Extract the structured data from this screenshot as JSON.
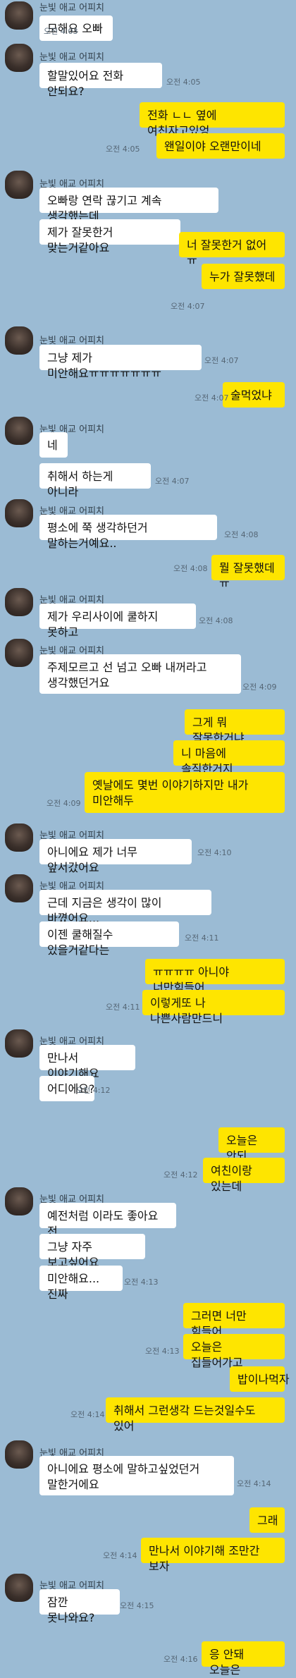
{
  "sender_name": "눈빛 애교 어피치",
  "messages": [
    {
      "text": "모해요 오빠",
      "time": "오전 4:03"
    },
    {
      "text": "할말있어요 전화 안되요?",
      "time": "오전 4:05"
    },
    {
      "text": "전화 ㄴㄴ 옆에 여친자고있엉",
      "time": ""
    },
    {
      "text": "왠일이야 오랜만이네",
      "time": "오전 4:05"
    },
    {
      "text": "오빠랑 연락 끊기고 계속 생각했는데",
      "time": ""
    },
    {
      "text": "제가 잘못한거 맞는거같아요",
      "time": "오전 4:06"
    },
    {
      "text": "너 잘못한거 없어 ㅠ",
      "time": ""
    },
    {
      "text": "누가 잘못했데",
      "time": "오전 4:07"
    },
    {
      "text": "그냥 제가 미안해요ㅠㅠㅠㅠㅠㅠㅠ",
      "time": "오전 4:07"
    },
    {
      "text": "술먹었냐",
      "time": "오전 4:07"
    },
    {
      "text": "네",
      "time": ""
    },
    {
      "text": "취해서 하는게 아니라",
      "time": "오전 4:07"
    },
    {
      "text": "평소에 쭉 생각하던거 말하는거예요..",
      "time": "오전 4:08"
    },
    {
      "text": "뭘 잘못했데 ㅠ",
      "time": "오전 4:08"
    },
    {
      "text": "제가 우리사이에 쿨하지 못하고",
      "time": "오전 4:08"
    },
    {
      "text": "주제모르고 선 넘고 오빠 내꺼라고 생각했던거요",
      "time": "오전 4:09"
    },
    {
      "text": "그게 뭐 잘못한거냐",
      "time": ""
    },
    {
      "text": "니 마음에 솔직한거지",
      "time": ""
    },
    {
      "text": "옛날에도 몇번 이야기하지만 내가 미안해두",
      "time": "오전 4:09"
    },
    {
      "text": "아니에요 제가 너무 앞서갔어요",
      "time": "오전 4:10"
    },
    {
      "text": "근데 지금은 생각이 많이 바꼈어요...",
      "time": ""
    },
    {
      "text": "이젠 쿨해질수 있을거같다는",
      "time": "오전 4:11"
    },
    {
      "text": "ㅠㅠㅠㅠ 아니야 너만힘들어",
      "time": ""
    },
    {
      "text": "이렇게또 나 나쁜사람만드니",
      "time": "오전 4:11"
    },
    {
      "text": "만나서 이야기해요",
      "time": ""
    },
    {
      "text": "어디에요?",
      "time": "오전 4:12"
    },
    {
      "text": "오늘은 안되",
      "time": ""
    },
    {
      "text": "여친이랑 있는데",
      "time": "오전 4:12"
    },
    {
      "text": "예전처럼 이라도 좋아요 전",
      "time": ""
    },
    {
      "text": "그냥 자주 보고싶어요",
      "time": ""
    },
    {
      "text": "미안해요...진짜",
      "time": "오전 4:13"
    },
    {
      "text": "그러면 너만 힘들어",
      "time": ""
    },
    {
      "text": "오늘은 집들어가고",
      "time": "오전 4:13"
    },
    {
      "text": "밥이나먹자",
      "time": ""
    },
    {
      "text": "취해서 그런생각 드는것일수도 있어",
      "time": "오전 4:14"
    },
    {
      "text": "아니에요 평소에 말하고싶었던거 말한거에요",
      "time": "오전 4:14"
    },
    {
      "text": "그래",
      "time": ""
    },
    {
      "text": "만나서 이야기해 조만간 보자",
      "time": "오전 4:14"
    },
    {
      "text": "잠깐 못나와요?",
      "time": "오전 4:15"
    },
    {
      "text": "응 안돼 오늘은",
      "time": "오전 4:16"
    }
  ],
  "colors": {
    "background": "#9bbbd4",
    "incoming_bubble": "#ffffff",
    "outgoing_bubble": "#fee500"
  }
}
